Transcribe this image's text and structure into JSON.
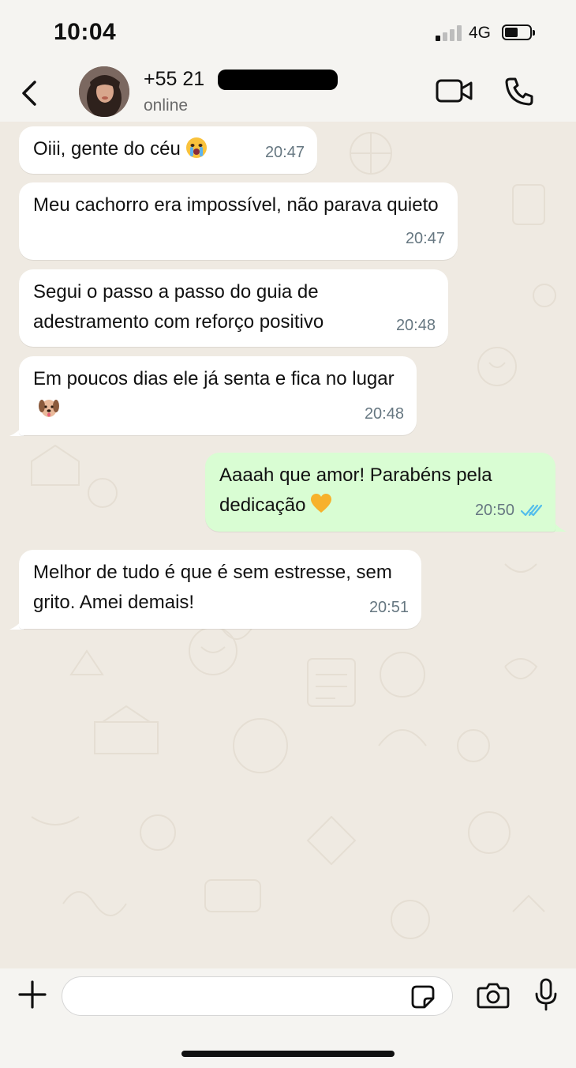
{
  "status_bar": {
    "time": "10:04",
    "network": "4G",
    "signal_bars_active": 1,
    "signal_bars_total": 4,
    "battery_level": 0.45
  },
  "header": {
    "contact_name": "+55 21",
    "contact_status": "online",
    "back_icon": "chevron-left-icon",
    "video_icon": "video-camera-icon",
    "call_icon": "phone-icon"
  },
  "messages": [
    {
      "direction": "incoming",
      "text": "Oiii, gente do céu",
      "emoji": "crying-face",
      "time": "20:47"
    },
    {
      "direction": "incoming",
      "text": "Meu cachorro era impossível, não parava quieto",
      "time": "20:47"
    },
    {
      "direction": "incoming",
      "text": "Segui o passo a passo do guia de adestramento com reforço positivo",
      "time": "20:48"
    },
    {
      "direction": "incoming",
      "text": "Em poucos dias ele já senta e fica no lugar",
      "emoji": "dog-face",
      "time": "20:48"
    },
    {
      "direction": "outgoing",
      "text": "Aaaah que amor! Parabéns pela dedicação",
      "emoji": "yellow-heart",
      "time": "20:50",
      "read": true
    },
    {
      "direction": "incoming",
      "text": "Melhor de tudo é que é sem estresse, sem grito. Amei demais!",
      "time": "20:51"
    }
  ],
  "input": {
    "placeholder": "",
    "value": ""
  },
  "colors": {
    "incoming_bubble": "#ffffff",
    "outgoing_bubble": "#d9fdd3",
    "read_ticks": "#53bdeb",
    "chat_background": "#efeae2"
  }
}
